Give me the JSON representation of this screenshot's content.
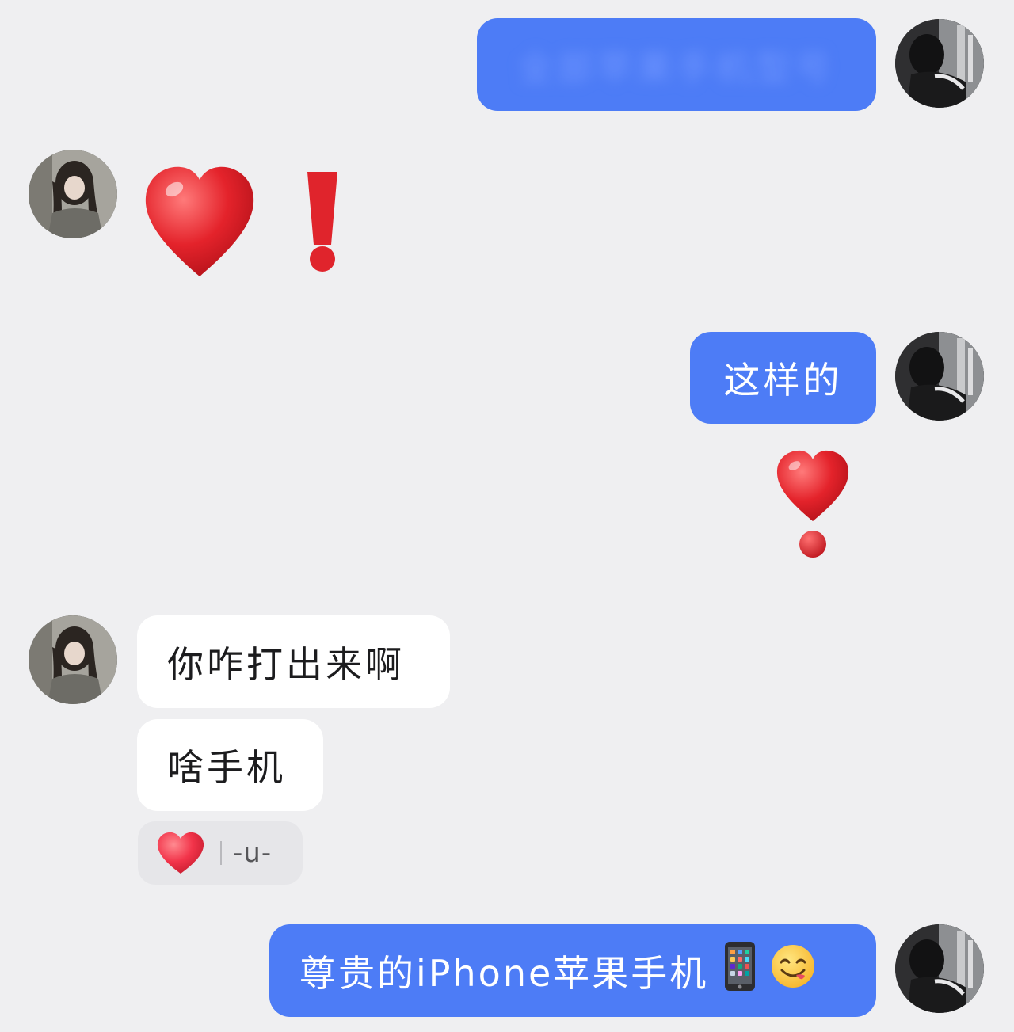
{
  "messages": {
    "m1": {
      "sender": "self",
      "text": "全部苹果手机型号",
      "blurred": true
    },
    "m2": {
      "sender": "other",
      "content": "heart-exclamation-emoji"
    },
    "m3": {
      "sender": "self",
      "text": "这样的"
    },
    "m4": {
      "sender": "self",
      "content": "heavy-heart-exclamation-emoji"
    },
    "m5": {
      "sender": "other",
      "text": "你咋打出来啊"
    },
    "m6": {
      "sender": "other",
      "text": "啥手机",
      "reaction": {
        "icon": "heart-icon",
        "text": "-u-"
      }
    },
    "m7": {
      "sender": "self",
      "text": "尊贵的iPhone苹果手机",
      "emojis": [
        "mobile-phone-emoji",
        "yum-face-emoji"
      ]
    }
  },
  "colors": {
    "background": "#efeff1",
    "self_bubble": "#4d7cf6",
    "other_bubble": "#ffffff",
    "heart_red": "#e0242c"
  }
}
